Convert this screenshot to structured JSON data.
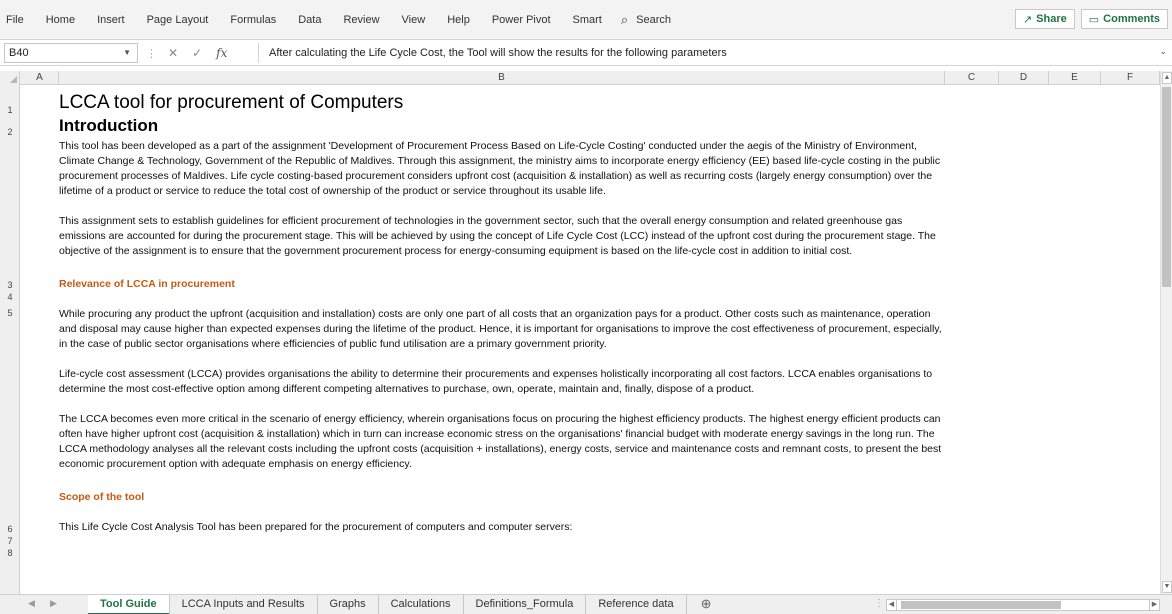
{
  "ribbon": {
    "menu": [
      "File",
      "Home",
      "Insert",
      "Page Layout",
      "Formulas",
      "Data",
      "Review",
      "View",
      "Help",
      "Power Pivot",
      "Smart"
    ],
    "search_label": "Search",
    "share_label": "Share",
    "comments_label": "Comments"
  },
  "formula_bar": {
    "cell_ref": "B40",
    "formula": "After calculating the Life Cycle Cost, the Tool will show the results for the following parameters"
  },
  "columns": [
    "A",
    "B",
    "C",
    "D",
    "E",
    "F"
  ],
  "rows": [
    "1",
    "2",
    "3",
    "4",
    "5",
    "6",
    "7",
    "8"
  ],
  "sheet": {
    "title": "LCCA tool for procurement of Computers",
    "heading": "Introduction",
    "intro_p1": "This tool has been developed as a part of the assignment 'Development of Procurement Process Based on Life-Cycle Costing' conducted under the aegis of the Ministry of Environment, Climate Change & Technology, Government of the Republic of Maldives. Through this assignment, the ministry aims to incorporate energy efficiency (EE) based life-cycle costing in the public procurement processes of Maldives. Life cycle costing-based procurement considers upfront cost (acquisition & installation) as well as recurring costs (largely energy consumption) over the lifetime of a product or service to reduce the total cost of ownership of the product or service throughout its usable life.",
    "intro_p2": "This assignment sets to establish guidelines for efficient procurement of technologies in the government sector, such that the overall energy consumption and related greenhouse gas emissions are accounted for during the procurement stage. This will be achieved by using the concept of Life Cycle Cost (LCC) instead of the upfront cost during the procurement stage. The objective of the assignment is to ensure that the government procurement process for energy-consuming equipment is based on the life-cycle cost in addition to initial cost.",
    "relevance_heading": "Relevance of LCCA in procurement",
    "relevance_p1": "While procuring any product the upfront (acquisition and installation) costs are only one part of all costs that an organization pays for a product. Other costs such as maintenance, operation and disposal may cause higher than expected expenses during the lifetime of the product. Hence, it is important for organisations to improve the cost effectiveness of procurement, especially, in the case of public sector organisations where efficiencies of public fund utilisation are a primary government priority.",
    "relevance_p2": "Life-cycle cost assessment (LCCA) provides organisations the ability to determine their procurements and expenses holistically incorporating all cost factors. LCCA enables organisations to determine the most cost-effective option among different competing alternatives to purchase, own, operate, maintain and, finally, dispose of a product.",
    "relevance_p3": "The LCCA  becomes even more critical in the scenario of energy efficiency, wherein organisations focus on procuring the highest efficiency products. The highest energy efficient products can often have higher upfront cost (acquisition & installation) which in turn can increase economic stress on the organisations' financial budget with moderate energy savings in the long run. The LCCA methodology analyses all the relevant costs including the upfront costs (acquisition + installations), energy costs, service and maintenance costs and remnant costs, to present the best economic procurement option with adequate emphasis on energy efficiency.",
    "scope_heading": "Scope of the tool",
    "scope_p1": "This Life Cycle Cost Analysis Tool has been prepared for the procurement of computers and computer servers:"
  },
  "tabs": [
    "Tool Guide",
    "LCCA Inputs and Results",
    "Graphs",
    "Calculations",
    "Definitions_Formula",
    "Reference data"
  ],
  "active_tab": "Tool Guide",
  "colors": {
    "accent": "#217346",
    "subhead": "#c55a11"
  },
  "icons": {
    "search": "search-icon",
    "share": "share-icon",
    "comments": "comment-icon",
    "cancel": "cancel-icon",
    "enter": "check-icon",
    "function": "function-icon",
    "add_sheet": "plus-circle-icon"
  }
}
